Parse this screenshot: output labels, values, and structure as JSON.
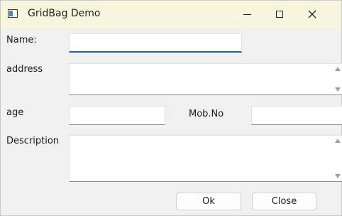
{
  "window": {
    "title": "GridBag Demo",
    "minimize_icon": "minimize-icon",
    "maximize_icon": "maximize-icon",
    "close_icon": "close-icon"
  },
  "form": {
    "name_label": "Name:",
    "name_value": "",
    "address_label": "address",
    "address_value": "",
    "age_label": "age",
    "age_value": "",
    "mob_label": "Mob.No",
    "mob_value": "",
    "description_label": "Description",
    "description_value": ""
  },
  "buttons": {
    "ok_label": "Ok",
    "close_label": "Close"
  },
  "colors": {
    "titlebar_bg": "#f6f6dc",
    "focus_accent": "#1c5fb4",
    "window_bg": "#f0f0f0"
  }
}
